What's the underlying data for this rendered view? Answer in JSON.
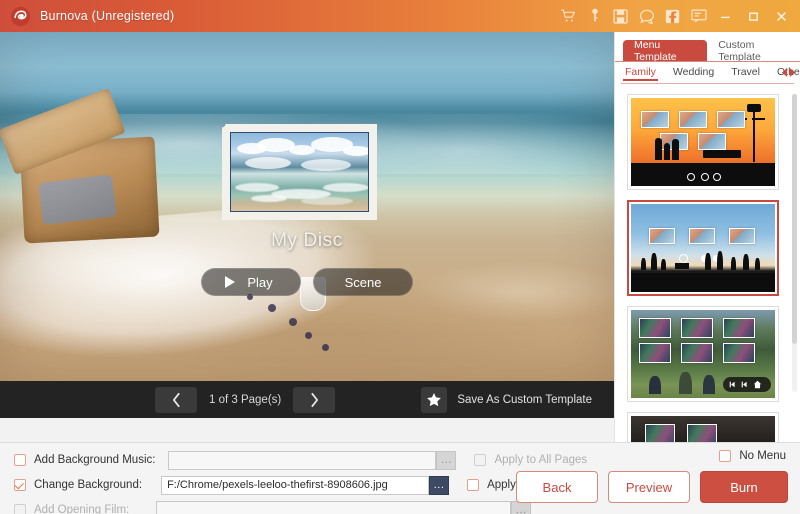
{
  "titlebar": {
    "app_title": "Burnova (Unregistered)",
    "logo_icon": "burnova-logo-icon",
    "icons": [
      {
        "name": "cart-icon",
        "glyph": "cart"
      },
      {
        "name": "key-icon",
        "glyph": "key"
      },
      {
        "name": "save-icon",
        "glyph": "save"
      },
      {
        "name": "help-icon",
        "glyph": "help"
      },
      {
        "name": "facebook-icon",
        "glyph": "facebook"
      },
      {
        "name": "feedback-icon",
        "glyph": "feedback"
      }
    ],
    "window_controls": {
      "minimize": "minimize-icon",
      "maximize": "maximize-icon",
      "close": "close-icon"
    },
    "gradient_from": "#cf4e3b",
    "gradient_to": "#efa93f"
  },
  "preview": {
    "disc_title": "My Disc",
    "play_label": "Play",
    "scene_label": "Scene",
    "background_description": "beach picnic basket on sand with ocean waves"
  },
  "toolbar": {
    "prev_label": "‹",
    "next_label": "›",
    "page_text": "1 of 3 Page(s)",
    "save_template_label": "Save As Custom Template",
    "star_icon": "star-icon"
  },
  "right_panel": {
    "tabs": [
      {
        "label": "Menu Template",
        "active": true
      },
      {
        "label": "Custom Template",
        "active": false
      }
    ],
    "subtabs": [
      {
        "label": "Family",
        "active": true
      },
      {
        "label": "Wedding",
        "active": false
      },
      {
        "label": "Travel",
        "active": false
      },
      {
        "label": "Others",
        "active": false
      }
    ],
    "subtab_arrow_left": "arrow-left-icon",
    "subtab_arrow_right": "arrow-right-icon",
    "templates": [
      {
        "name": "sunset-family-template",
        "selected": false
      },
      {
        "name": "blue-beach-template",
        "selected": true
      },
      {
        "name": "forest-picnic-template",
        "selected": false
      },
      {
        "name": "dark-film-template",
        "selected": false
      }
    ],
    "accent_color": "#c94a3f"
  },
  "bottom": {
    "background_music": {
      "label": "Add Background Music:",
      "checked": false,
      "value": "",
      "placeholder": "",
      "browse_label": "...",
      "apply_label": "Apply to All Pages",
      "apply_checked": false,
      "disabled": true
    },
    "change_background": {
      "label": "Change Background:",
      "checked": true,
      "value": "F:/Chrome/pexels-leeloo-thefirst-8908606.jpg",
      "browse_label": "...",
      "apply_label": "Apply to All Pages",
      "apply_checked": false,
      "disabled": false
    },
    "opening_film": {
      "label": "Add Opening Film:",
      "checked": false,
      "value": "",
      "browse_label": "...",
      "disabled": true
    },
    "no_menu": {
      "label": "No Menu",
      "checked": false
    },
    "buttons": {
      "back": "Back",
      "preview": "Preview",
      "burn": "Burn"
    },
    "burn_color": "#cd4f41"
  }
}
